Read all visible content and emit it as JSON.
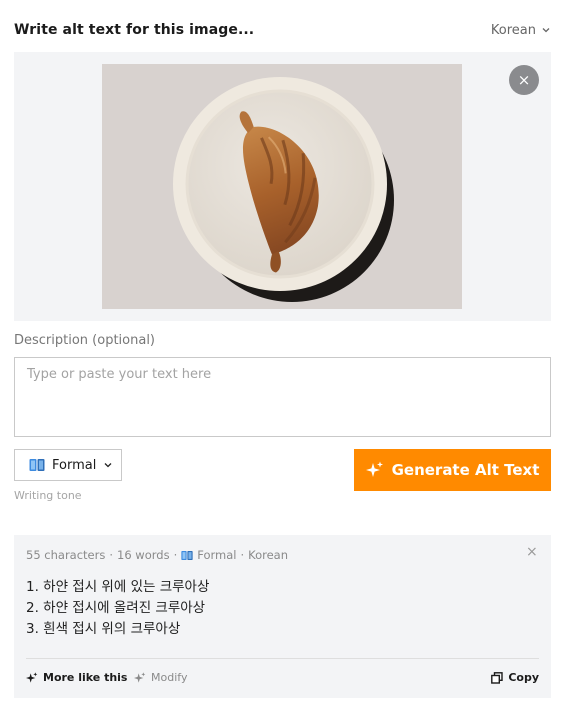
{
  "header": {
    "title": "Write alt text for this image...",
    "language": "Korean"
  },
  "image_panel": {
    "remove_label": "×"
  },
  "description": {
    "label": "Description (optional)",
    "placeholder": "Type or paste your text here",
    "value": ""
  },
  "tone": {
    "selected": "Formal",
    "caption": "Writing tone",
    "icon": "book-icon"
  },
  "generate": {
    "label": "Generate Alt Text",
    "icon": "sparkles-icon",
    "color": "#ff8a00"
  },
  "result": {
    "characters": "55 characters",
    "words": "16 words",
    "tone": "Formal",
    "language": "Korean",
    "separator": "·",
    "close_label": "×",
    "items": [
      "1. 하얀 접시 위에 있는 크루아상",
      "2. 하얀 접시에 올려진 크루아상",
      "3. 흰색 접시 위의 크루아상"
    ],
    "actions": {
      "more": "More like this",
      "modify": "Modify",
      "copy": "Copy"
    }
  }
}
